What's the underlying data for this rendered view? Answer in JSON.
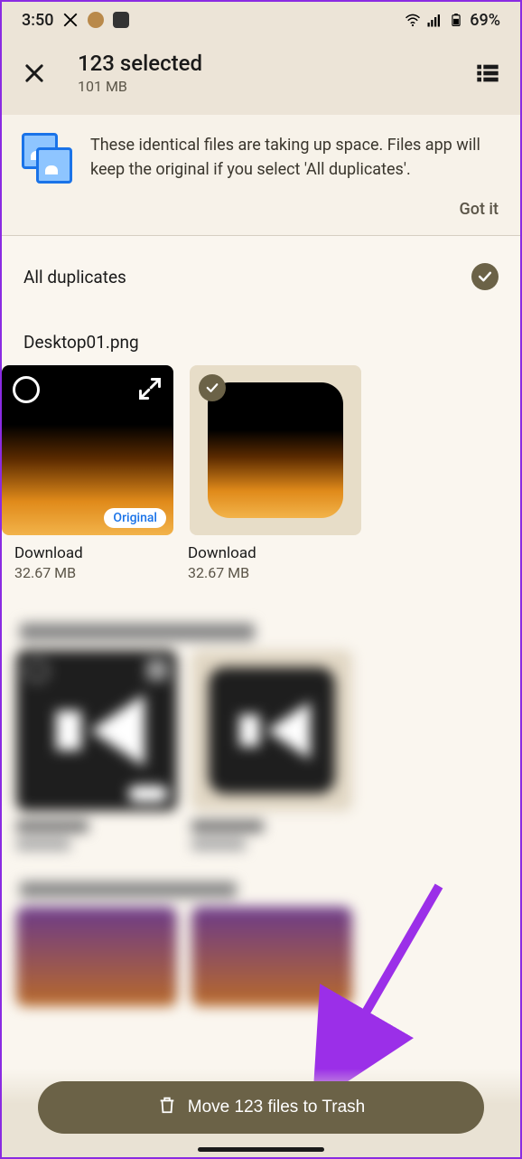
{
  "status": {
    "time": "3:50",
    "battery": "69%"
  },
  "header": {
    "title": "123 selected",
    "subtitle": "101 MB"
  },
  "info": {
    "message": "These identical files are taking up space. Files app will keep the original if you select 'All duplicates'.",
    "action": "Got it"
  },
  "all_duplicates_label": "All duplicates",
  "group1": {
    "title": "Desktop01.png",
    "items": [
      {
        "location": "Download",
        "size": "32.67 MB",
        "badge": "Original"
      },
      {
        "location": "Download",
        "size": "32.67 MB"
      }
    ]
  },
  "bottom": {
    "button": "Move 123 files to Trash"
  }
}
